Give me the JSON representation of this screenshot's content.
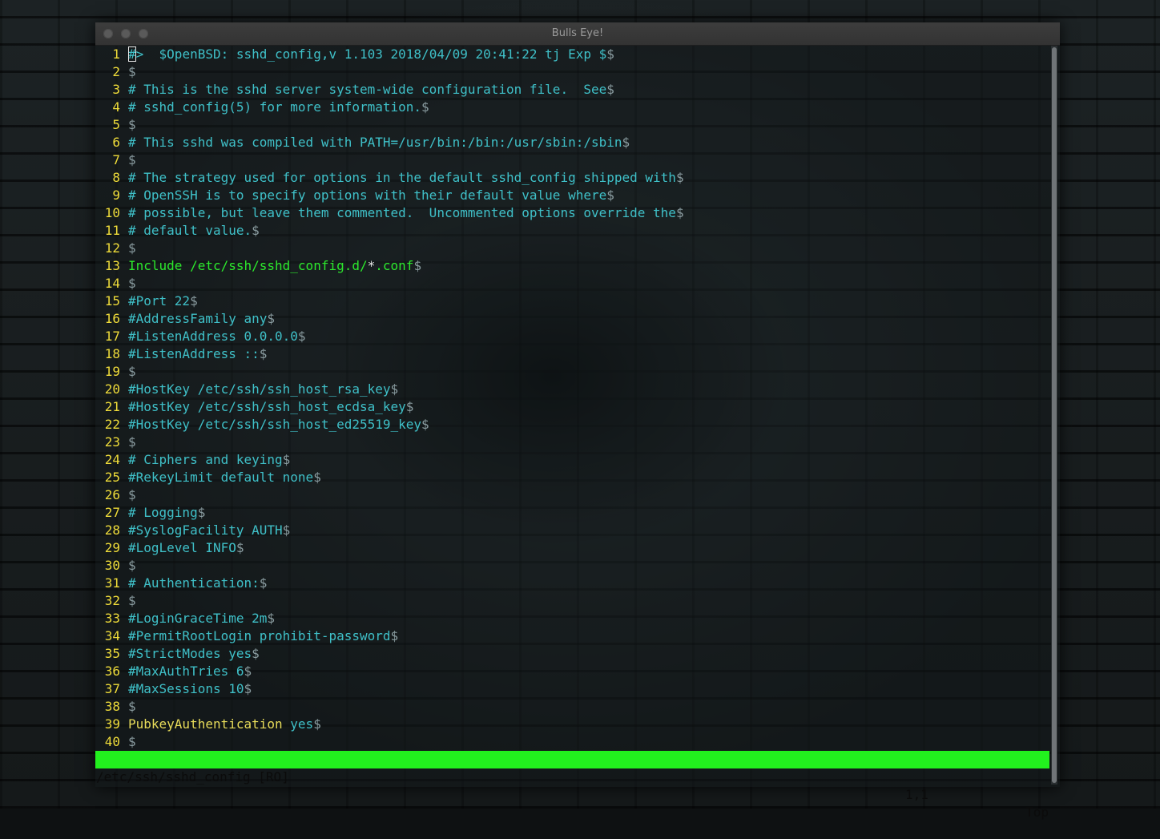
{
  "window": {
    "title": "Bulls Eye!"
  },
  "editor": {
    "lines": [
      {
        "n": "1",
        "parts": [
          {
            "t": "#",
            "c": "txt",
            "cursor": true
          },
          {
            "t": ">  $OpenBSD: sshd_config,v 1.103 2018/04/09 20:41:22 tj Exp $",
            "c": "txt"
          },
          {
            "t": "$",
            "c": "eol"
          }
        ]
      },
      {
        "n": "2",
        "parts": [
          {
            "t": "$",
            "c": "eol"
          }
        ]
      },
      {
        "n": "3",
        "parts": [
          {
            "t": "# This is the sshd server system-wide configuration file.  See",
            "c": "txt"
          },
          {
            "t": "$",
            "c": "eol"
          }
        ]
      },
      {
        "n": "4",
        "parts": [
          {
            "t": "# sshd_config(5) for more information.",
            "c": "txt"
          },
          {
            "t": "$",
            "c": "eol"
          }
        ]
      },
      {
        "n": "5",
        "parts": [
          {
            "t": "$",
            "c": "eol"
          }
        ]
      },
      {
        "n": "6",
        "parts": [
          {
            "t": "# This sshd was compiled with PATH=/usr/bin:/bin:/usr/sbin:/sbin",
            "c": "txt"
          },
          {
            "t": "$",
            "c": "eol"
          }
        ]
      },
      {
        "n": "7",
        "parts": [
          {
            "t": "$",
            "c": "eol"
          }
        ]
      },
      {
        "n": "8",
        "parts": [
          {
            "t": "# The strategy used for options in the default sshd_config shipped with",
            "c": "txt"
          },
          {
            "t": "$",
            "c": "eol"
          }
        ]
      },
      {
        "n": "9",
        "parts": [
          {
            "t": "# OpenSSH is to specify options with their default value where",
            "c": "txt"
          },
          {
            "t": "$",
            "c": "eol"
          }
        ]
      },
      {
        "n": "10",
        "parts": [
          {
            "t": "# possible, but leave them commented.  Uncommented options override the",
            "c": "txt"
          },
          {
            "t": "$",
            "c": "eol"
          }
        ]
      },
      {
        "n": "11",
        "parts": [
          {
            "t": "# default value.",
            "c": "txt"
          },
          {
            "t": "$",
            "c": "eol"
          }
        ]
      },
      {
        "n": "12",
        "parts": [
          {
            "t": "$",
            "c": "eol"
          }
        ]
      },
      {
        "n": "13",
        "parts": [
          {
            "t": "Include /etc/ssh/sshd_config.d/",
            "c": "inc"
          },
          {
            "t": "*",
            "c": "inc-star"
          },
          {
            "t": ".conf",
            "c": "inc"
          },
          {
            "t": "$",
            "c": "eol"
          }
        ]
      },
      {
        "n": "14",
        "parts": [
          {
            "t": "$",
            "c": "eol"
          }
        ]
      },
      {
        "n": "15",
        "parts": [
          {
            "t": "#Port 22",
            "c": "txt"
          },
          {
            "t": "$",
            "c": "eol"
          }
        ]
      },
      {
        "n": "16",
        "parts": [
          {
            "t": "#AddressFamily any",
            "c": "txt"
          },
          {
            "t": "$",
            "c": "eol"
          }
        ]
      },
      {
        "n": "17",
        "parts": [
          {
            "t": "#ListenAddress 0.0.0.0",
            "c": "txt"
          },
          {
            "t": "$",
            "c": "eol"
          }
        ]
      },
      {
        "n": "18",
        "parts": [
          {
            "t": "#ListenAddress ::",
            "c": "txt"
          },
          {
            "t": "$",
            "c": "eol"
          }
        ]
      },
      {
        "n": "19",
        "parts": [
          {
            "t": "$",
            "c": "eol"
          }
        ]
      },
      {
        "n": "20",
        "parts": [
          {
            "t": "#HostKey /etc/ssh/ssh_host_rsa_key",
            "c": "txt"
          },
          {
            "t": "$",
            "c": "eol"
          }
        ]
      },
      {
        "n": "21",
        "parts": [
          {
            "t": "#HostKey /etc/ssh/ssh_host_ecdsa_key",
            "c": "txt"
          },
          {
            "t": "$",
            "c": "eol"
          }
        ]
      },
      {
        "n": "22",
        "parts": [
          {
            "t": "#HostKey /etc/ssh/ssh_host_ed25519_key",
            "c": "txt"
          },
          {
            "t": "$",
            "c": "eol"
          }
        ]
      },
      {
        "n": "23",
        "parts": [
          {
            "t": "$",
            "c": "eol"
          }
        ]
      },
      {
        "n": "24",
        "parts": [
          {
            "t": "# Ciphers and keying",
            "c": "txt"
          },
          {
            "t": "$",
            "c": "eol"
          }
        ]
      },
      {
        "n": "25",
        "parts": [
          {
            "t": "#RekeyLimit default none",
            "c": "txt"
          },
          {
            "t": "$",
            "c": "eol"
          }
        ]
      },
      {
        "n": "26",
        "parts": [
          {
            "t": "$",
            "c": "eol"
          }
        ]
      },
      {
        "n": "27",
        "parts": [
          {
            "t": "# Logging",
            "c": "txt"
          },
          {
            "t": "$",
            "c": "eol"
          }
        ]
      },
      {
        "n": "28",
        "parts": [
          {
            "t": "#SyslogFacility AUTH",
            "c": "txt"
          },
          {
            "t": "$",
            "c": "eol"
          }
        ]
      },
      {
        "n": "29",
        "parts": [
          {
            "t": "#LogLevel INFO",
            "c": "txt"
          },
          {
            "t": "$",
            "c": "eol"
          }
        ]
      },
      {
        "n": "30",
        "parts": [
          {
            "t": "$",
            "c": "eol"
          }
        ]
      },
      {
        "n": "31",
        "parts": [
          {
            "t": "# Authentication:",
            "c": "txt"
          },
          {
            "t": "$",
            "c": "eol"
          }
        ]
      },
      {
        "n": "32",
        "parts": [
          {
            "t": "$",
            "c": "eol"
          }
        ]
      },
      {
        "n": "33",
        "parts": [
          {
            "t": "#LoginGraceTime 2m",
            "c": "txt"
          },
          {
            "t": "$",
            "c": "eol"
          }
        ]
      },
      {
        "n": "34",
        "parts": [
          {
            "t": "#PermitRootLogin prohibit-password",
            "c": "txt"
          },
          {
            "t": "$",
            "c": "eol"
          }
        ]
      },
      {
        "n": "35",
        "parts": [
          {
            "t": "#StrictModes yes",
            "c": "txt"
          },
          {
            "t": "$",
            "c": "eol"
          }
        ]
      },
      {
        "n": "36",
        "parts": [
          {
            "t": "#MaxAuthTries 6",
            "c": "txt"
          },
          {
            "t": "$",
            "c": "eol"
          }
        ]
      },
      {
        "n": "37",
        "parts": [
          {
            "t": "#MaxSessions 10",
            "c": "txt"
          },
          {
            "t": "$",
            "c": "eol"
          }
        ]
      },
      {
        "n": "38",
        "parts": [
          {
            "t": "$",
            "c": "eol"
          }
        ]
      },
      {
        "n": "39",
        "parts": [
          {
            "t": "PubkeyAuthentication",
            "c": "kw"
          },
          {
            "t": " yes",
            "c": "val"
          },
          {
            "t": "$",
            "c": "eol"
          }
        ]
      },
      {
        "n": "40",
        "parts": [
          {
            "t": "$",
            "c": "eol"
          }
        ]
      }
    ]
  },
  "statusbar": {
    "file": "/etc/ssh/sshd_config [RO]",
    "position": "1,1",
    "scroll": "Top"
  },
  "colors": {
    "line_number": "#f0dd3a",
    "comment": "#3fc0c8",
    "keyword": "#e8dc5a",
    "include": "#2ce82c",
    "statusbar_bg": "#22f01e"
  }
}
